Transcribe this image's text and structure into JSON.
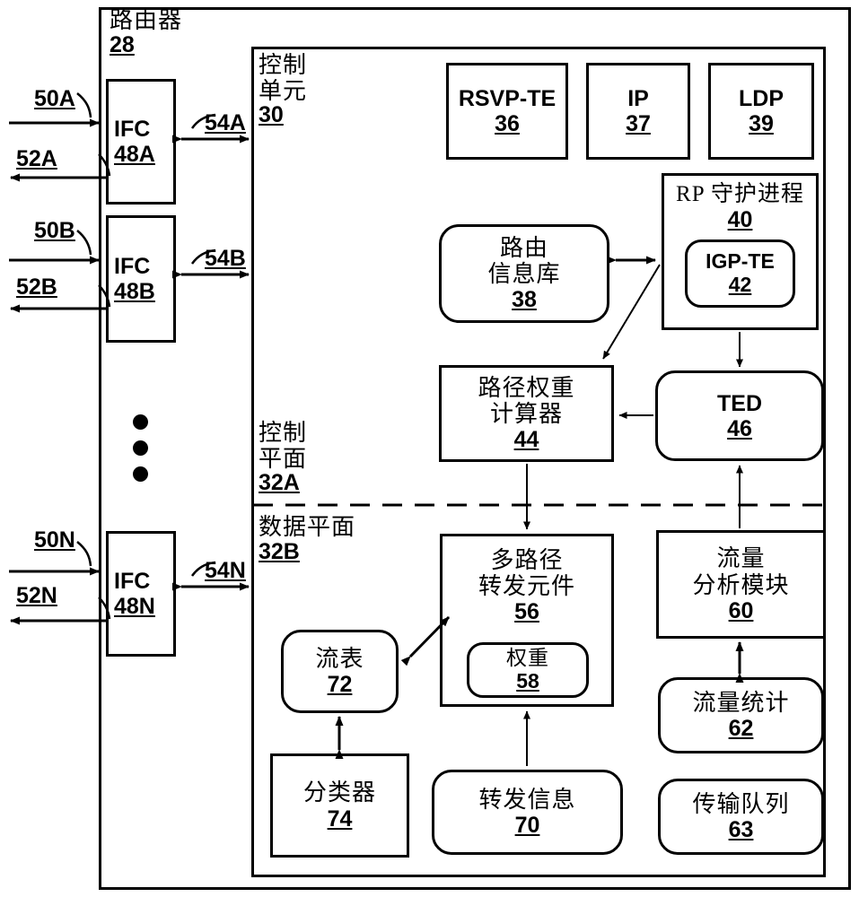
{
  "figure": {
    "router": {
      "label": "路由器",
      "num": "28"
    },
    "control_unit": {
      "label_line1": "控制",
      "label_line2": "单元",
      "num": "30"
    },
    "control_plane": {
      "label_line1": "控制",
      "label_line2": "平面",
      "num": "32A"
    },
    "data_plane": {
      "label": "数据平面",
      "num": "32B"
    }
  },
  "interfaces": [
    {
      "name": "IFC",
      "num": "48A",
      "in_ref": "50A",
      "out_ref": "52A",
      "link_ref": "54A"
    },
    {
      "name": "IFC",
      "num": "48B",
      "in_ref": "50B",
      "out_ref": "52B",
      "link_ref": "54B"
    },
    {
      "name": "IFC",
      "num": "48N",
      "in_ref": "50N",
      "out_ref": "52N",
      "link_ref": "54N"
    }
  ],
  "protocols": [
    {
      "label": "RSVP-TE",
      "num": "36"
    },
    {
      "label": "IP",
      "num": "37"
    },
    {
      "label": "LDP",
      "num": "39"
    }
  ],
  "control_blocks": {
    "rib": {
      "line1": "路由",
      "line2": "信息库",
      "num": "38"
    },
    "rp_daemon": {
      "label": "RP 守护进程",
      "num": "40"
    },
    "igp_te": {
      "label": "IGP-TE",
      "num": "42"
    },
    "path_weight_calc": {
      "line1": "路径权重",
      "line2": "计算器",
      "num": "44"
    },
    "ted": {
      "label": "TED",
      "num": "46"
    }
  },
  "data_blocks": {
    "multipath_fwd": {
      "line1": "多路径",
      "line2": "转发元件",
      "num": "56"
    },
    "weights": {
      "label": "权重",
      "num": "58"
    },
    "flow_table": {
      "label": "流表",
      "num": "72"
    },
    "classifier": {
      "label": "分类器",
      "num": "74"
    },
    "forwarding_info": {
      "label": "转发信息",
      "num": "70"
    },
    "traffic_analysis": {
      "line1": "流量",
      "line2": "分析模块",
      "num": "60"
    },
    "traffic_stats": {
      "label": "流量统计",
      "num": "62"
    },
    "transmit_queue": {
      "label": "传输队列",
      "num": "63"
    }
  },
  "colors": {
    "stroke": "#000000",
    "background": "#ffffff"
  }
}
